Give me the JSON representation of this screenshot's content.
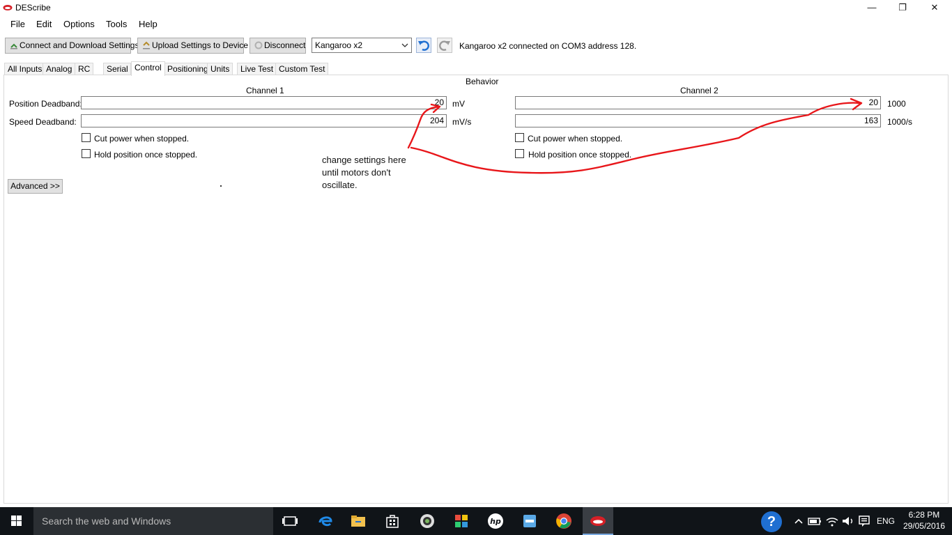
{
  "window": {
    "title": "DEScribe",
    "minimize_glyph": "—",
    "restore_glyph": "❐",
    "close_glyph": "✕"
  },
  "menu": [
    "File",
    "Edit",
    "Options",
    "Tools",
    "Help"
  ],
  "toolbar": {
    "connect_label": "Connect and Download Settings",
    "upload_label": "Upload Settings to Device",
    "disconnect_label": "Disconnect",
    "device_selected": "Kangaroo x2",
    "status_text": "Kangaroo x2 connected on COM3 address 128."
  },
  "tabs": [
    {
      "label": "All Inputs",
      "active": false
    },
    {
      "label": "Analog",
      "active": false
    },
    {
      "label": "RC",
      "active": false
    },
    {
      "label": "Serial",
      "active": false
    },
    {
      "label": "Control",
      "active": true
    },
    {
      "label": "Positioning",
      "active": false
    },
    {
      "label": "Units",
      "active": false
    },
    {
      "label": "Live Test",
      "active": false
    },
    {
      "label": "Custom Test",
      "active": false
    }
  ],
  "behavior": {
    "section_title": "Behavior",
    "position_deadband_label": "Position Deadband:",
    "speed_deadband_label": "Speed Deadband:",
    "channel1": {
      "title": "Channel 1",
      "position_value": "20",
      "position_unit": "mV",
      "speed_value": "204",
      "speed_unit": "mV/s",
      "cut_power_label": "Cut power when stopped.",
      "cut_power_checked": false,
      "hold_position_label": "Hold position once stopped.",
      "hold_position_checked": false
    },
    "channel2": {
      "title": "Channel 2",
      "position_value": "20",
      "position_unit": "1000",
      "speed_value": "163",
      "speed_unit": "1000/s",
      "cut_power_label": "Cut power when stopped.",
      "cut_power_checked": false,
      "hold_position_label": "Hold position once stopped.",
      "hold_position_checked": false
    },
    "advanced_label": "Advanced >>"
  },
  "annotation": {
    "line1": "change settings here",
    "line2": "until motors don't",
    "line3": "oscillate.",
    "color": "#e8161a"
  },
  "taskbar": {
    "search_placeholder": "Search the web and Windows",
    "language": "ENG",
    "time": "6:28 PM",
    "date": "29/05/2016",
    "help_glyph": "?"
  },
  "colors": {
    "accent_blue": "#1f6fd1",
    "taskbar_bg": "#101418"
  }
}
